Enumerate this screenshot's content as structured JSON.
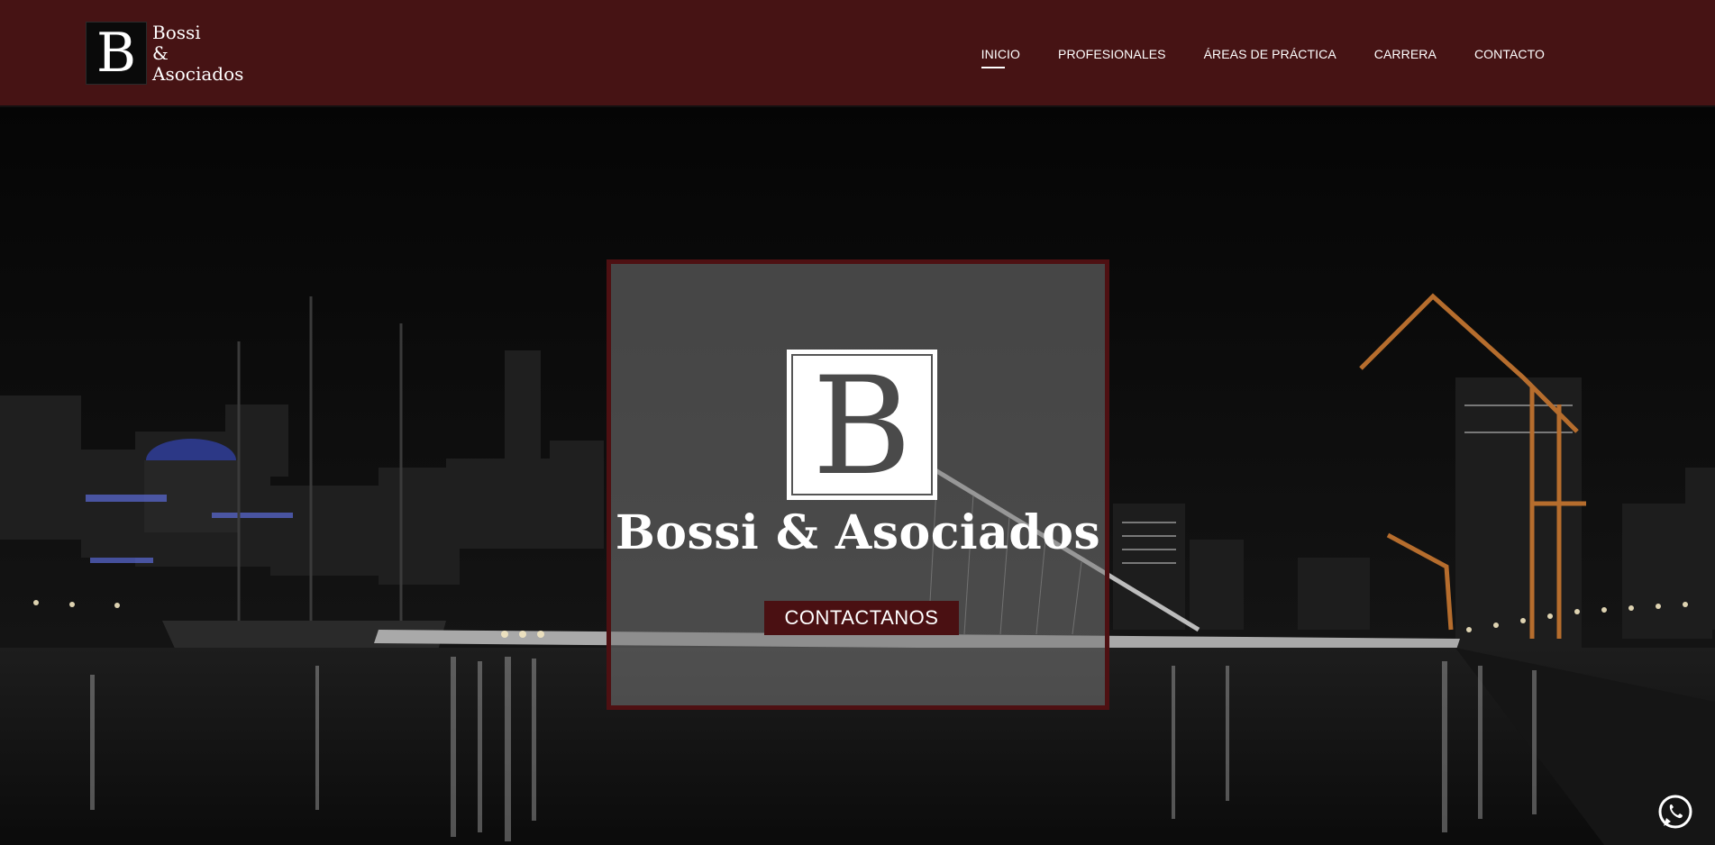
{
  "header": {
    "logo": {
      "mark": "B",
      "lines": [
        "Bossi",
        "&",
        "Asociados"
      ]
    },
    "nav": [
      {
        "label": "INICIO",
        "active": true
      },
      {
        "label": "PROFESIONALES",
        "active": false
      },
      {
        "label": "ÁREAS DE PRÁCTICA",
        "active": false
      },
      {
        "label": "CARRERA",
        "active": false
      },
      {
        "label": "CONTACTO",
        "active": false
      }
    ]
  },
  "hero": {
    "card": {
      "logo_mark": "B",
      "title": "Bossi & Asociados",
      "cta_label": "CONTACTANOS"
    }
  },
  "floating": {
    "whatsapp_icon": "whatsapp-icon"
  },
  "colors": {
    "brand": "#461314",
    "card_border": "#4e1012",
    "cta": "#4a1012"
  }
}
